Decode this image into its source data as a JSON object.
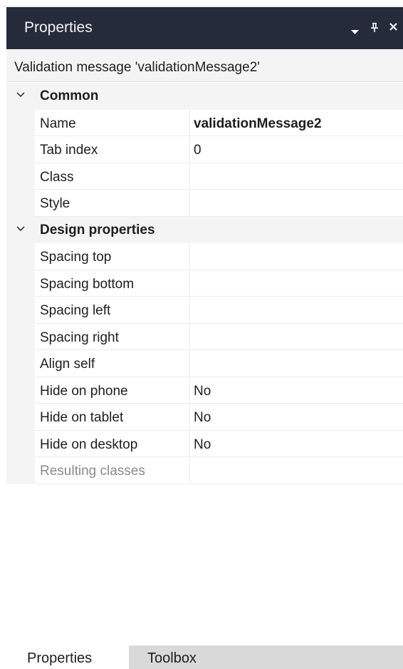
{
  "panel": {
    "title": "Properties",
    "controls": {
      "dropdown_icon": "caret-down-icon",
      "pin_icon": "pin-icon",
      "close_icon": "close-icon"
    }
  },
  "subject": "Validation message 'validationMessage2'",
  "categories": [
    {
      "label": "Common",
      "rows": [
        {
          "name": "Name",
          "value": "validationMessage2",
          "bold": true
        },
        {
          "name": "Tab index",
          "value": "0"
        },
        {
          "name": "Class",
          "value": ""
        },
        {
          "name": "Style",
          "value": ""
        }
      ]
    },
    {
      "label": "Design properties",
      "rows": [
        {
          "name": "Spacing top",
          "value": ""
        },
        {
          "name": "Spacing bottom",
          "value": ""
        },
        {
          "name": "Spacing left",
          "value": ""
        },
        {
          "name": "Spacing right",
          "value": ""
        },
        {
          "name": "Align self",
          "value": ""
        },
        {
          "name": "Hide on phone",
          "value": "No"
        },
        {
          "name": "Hide on tablet",
          "value": "No"
        },
        {
          "name": "Hide on desktop",
          "value": "No"
        },
        {
          "name": "Resulting classes",
          "value": "",
          "disabled": true
        }
      ]
    }
  ],
  "tabs": [
    {
      "label": "Properties",
      "active": true
    },
    {
      "label": "Toolbox",
      "active": false
    }
  ],
  "colors": {
    "titlebar": "#252b3b",
    "gutter": "#f4f4f4",
    "inactive_tab": "#d9d9d9",
    "disabled_text": "#8a8a8a"
  }
}
